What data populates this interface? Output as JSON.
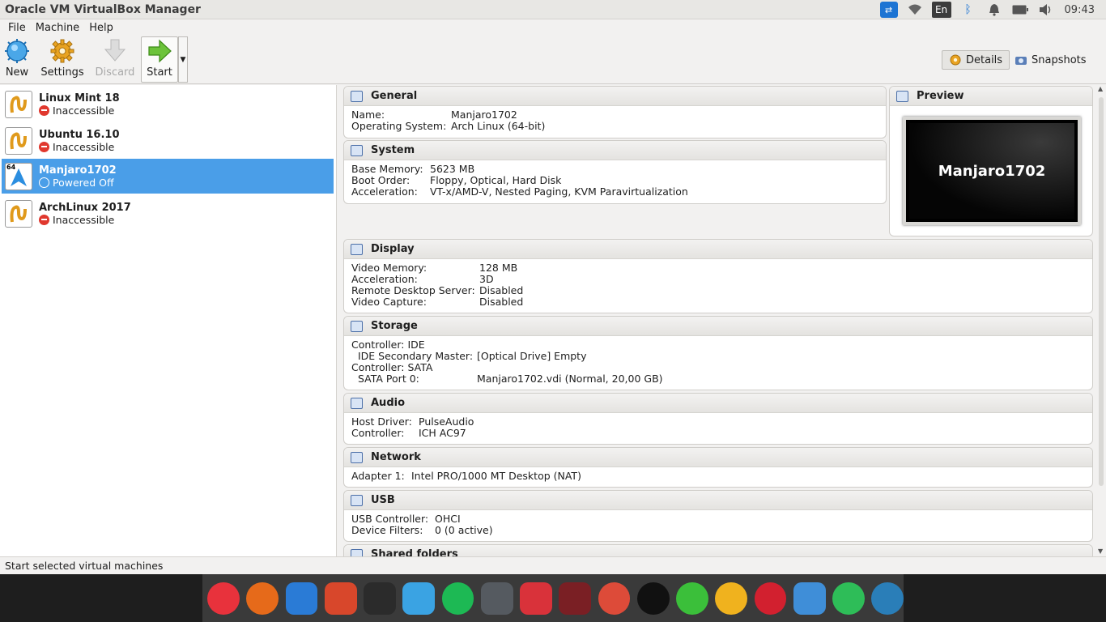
{
  "window": {
    "title": "Oracle VM VirtualBox Manager"
  },
  "tray": {
    "language": "En",
    "time": "09:43"
  },
  "menu": {
    "file": "File",
    "machine": "Machine",
    "help": "Help"
  },
  "toolbar": {
    "new_label": "New",
    "settings_label": "Settings",
    "discard_label": "Discard",
    "start_label": "Start",
    "details_label": "Details",
    "snapshots_label": "Snapshots"
  },
  "vms": [
    {
      "name": "Linux Mint 18",
      "state": "Inaccessible"
    },
    {
      "name": "Ubuntu 16.10",
      "state": "Inaccessible"
    },
    {
      "name": "Manjaro1702",
      "state": "Powered Off",
      "badge": "64"
    },
    {
      "name": "ArchLinux 2017",
      "state": "Inaccessible"
    }
  ],
  "details": {
    "general": {
      "title": "General",
      "rows": [
        {
          "k": "Name:",
          "v": "Manjaro1702"
        },
        {
          "k": "Operating System:",
          "v": "Arch Linux (64-bit)"
        }
      ]
    },
    "system": {
      "title": "System",
      "rows": [
        {
          "k": "Base Memory:",
          "v": "5623 MB"
        },
        {
          "k": "Boot Order:",
          "v": "Floppy, Optical, Hard Disk"
        },
        {
          "k": "Acceleration:",
          "v": "VT-x/AMD-V, Nested Paging, KVM Paravirtualization"
        }
      ]
    },
    "preview": {
      "title": "Preview",
      "screen_text": "Manjaro1702"
    },
    "display": {
      "title": "Display",
      "rows": [
        {
          "k": "Video Memory:",
          "v": "128 MB"
        },
        {
          "k": "Acceleration:",
          "v": "3D"
        },
        {
          "k": "Remote Desktop Server:",
          "v": "Disabled"
        },
        {
          "k": "Video Capture:",
          "v": "Disabled"
        }
      ]
    },
    "storage": {
      "title": "Storage",
      "rows": [
        {
          "k": "Controller: IDE",
          "v": ""
        },
        {
          "k": "IDE Secondary Master:",
          "v": "[Optical Drive] Empty"
        },
        {
          "k": "Controller: SATA",
          "v": ""
        },
        {
          "k": "SATA Port 0:",
          "v": "Manjaro1702.vdi (Normal, 20,00 GB)"
        }
      ]
    },
    "audio": {
      "title": "Audio",
      "rows": [
        {
          "k": "Host Driver:",
          "v": "PulseAudio"
        },
        {
          "k": "Controller:",
          "v": "ICH AC97"
        }
      ]
    },
    "network": {
      "title": "Network",
      "rows": [
        {
          "k": "Adapter 1:",
          "v": "Intel PRO/1000 MT Desktop (NAT)"
        }
      ]
    },
    "usb": {
      "title": "USB",
      "rows": [
        {
          "k": "USB Controller:",
          "v": "OHCI"
        },
        {
          "k": "Device Filters:",
          "v": "0 (0 active)"
        }
      ]
    },
    "shared": {
      "title": "Shared folders"
    }
  },
  "status": {
    "text": "Start selected virtual machines"
  },
  "dock": [
    {
      "name": "itunes-icon",
      "color": "#e8323c"
    },
    {
      "name": "firefox-icon",
      "color": "#e66a1a"
    },
    {
      "name": "finder-icon",
      "color": "#2a7bd6"
    },
    {
      "name": "photo-booth-icon",
      "color": "#d8472b"
    },
    {
      "name": "terminal-icon",
      "color": "#2b2b2b"
    },
    {
      "name": "virtualbox-icon",
      "color": "#3aa3e3"
    },
    {
      "name": "spotify-icon",
      "color": "#1db954"
    },
    {
      "name": "screenshot-icon",
      "color": "#555a60"
    },
    {
      "name": "recorder-icon",
      "color": "#d9323a"
    },
    {
      "name": "media-app-icon",
      "color": "#7a1f24"
    },
    {
      "name": "chrome-icon",
      "color": "#dd4b39"
    },
    {
      "name": "obs-icon",
      "color": "#111111"
    },
    {
      "name": "wechat-icon",
      "color": "#3bbf3a"
    },
    {
      "name": "vlc-icon",
      "color": "#f0b21e"
    },
    {
      "name": "opera-icon",
      "color": "#d2202f"
    },
    {
      "name": "layers-icon",
      "color": "#3f8ed8"
    },
    {
      "name": "whatsapp-icon",
      "color": "#2ebd58"
    },
    {
      "name": "wordpress-icon",
      "color": "#2a7eb8"
    }
  ]
}
